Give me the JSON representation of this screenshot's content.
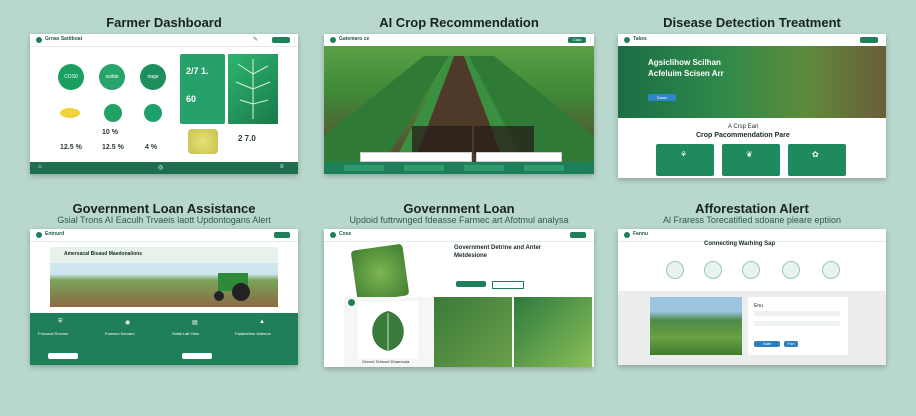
{
  "titles": {
    "t1": "Farmer Dashboard",
    "t2": "AI Crop Recommendation",
    "t3": "Disease Detection Treatment",
    "t4": "Government Loan Assistance",
    "t5": "Government Loan",
    "t6": "Afforestation Alert"
  },
  "subtitles": {
    "s4": "Gsial Trons AI Eaculh Trvaeis laott Updontogans Alert",
    "s5": "Updoid futtrwnged fdeasse Farmec art Afotmul analysa",
    "s6": "Al Fraress Torecatified sdoane pleare eptiion"
  },
  "p1": {
    "brand": "Grnas Satitboat",
    "circles": [
      "COS0",
      "soilde",
      "riage"
    ],
    "stats": [
      "2/7 1.",
      "60",
      "12.5 %",
      "10 %",
      "12.5 %",
      "4 %"
    ],
    "stat2": "2 7.0"
  },
  "p2": {
    "brand": "Gatemaro ce",
    "cta": "Ciao"
  },
  "p3": {
    "brand": "Takes",
    "hero_line1": "Agsiclihow Scilhan",
    "hero_line2": "Acfeluim Scisen Arr",
    "section_l1": "A Crsp Eari",
    "section_l2": "Crop Pacommendation Pare",
    "cta": "Saaru"
  },
  "p4": {
    "brand": "Entnurd",
    "banner": "Amersacal Bisaud Maedonalions",
    "cols": [
      "Fmcunal Rorvms",
      "Fureses Sarnam",
      "Scitla Lalt Oars",
      "Fadanetloo Vatenue"
    ]
  },
  "p5": {
    "brand": "Cose",
    "heading_l1": "Government Detrine and Anter",
    "heading_l2": "Metdesione",
    "caption": "Grenrd Tehnoel Dharmuda"
  },
  "p6": {
    "brand": "Fannu",
    "heading": "Connecting Warhing Sap",
    "field_label": "Enu",
    "buttons": [
      "Sale",
      "Fon"
    ]
  },
  "colors": {
    "accent": "#1e7f58",
    "background": "#b9d8cd"
  }
}
